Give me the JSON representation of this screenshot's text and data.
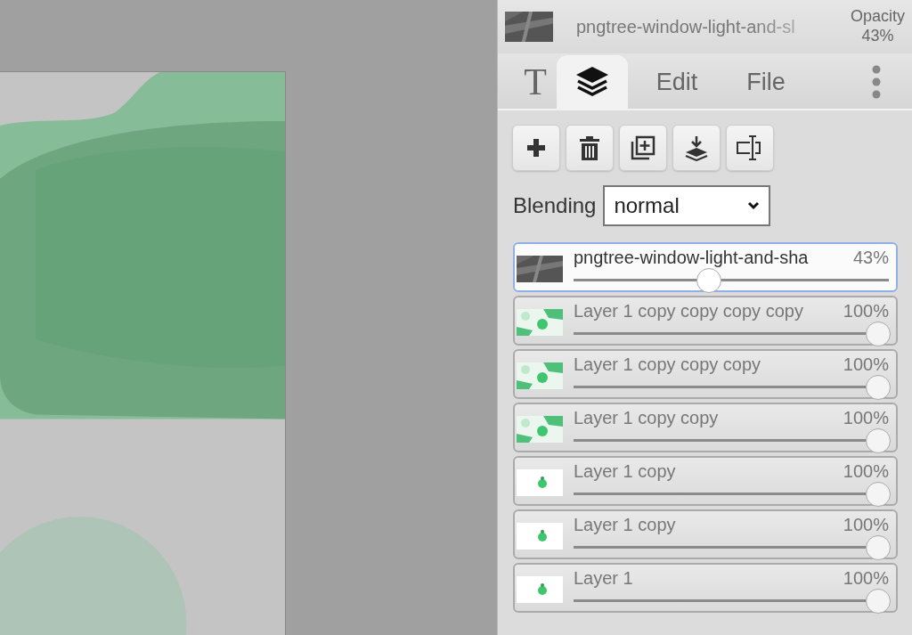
{
  "header": {
    "layer_name": "pngtree-window-light-and-sl",
    "opacity_label": "Opacity",
    "opacity_value": "43%"
  },
  "tabs": [
    {
      "kind": "glyph",
      "label": "T",
      "selected": false
    },
    {
      "kind": "icon",
      "selected": true
    },
    {
      "kind": "text",
      "label": "Edit",
      "selected": false
    },
    {
      "kind": "text",
      "label": "File",
      "selected": false
    }
  ],
  "blending": {
    "label": "Blending",
    "value": "normal"
  },
  "layers": [
    {
      "name": "pngtree-window-light-and-sha",
      "opacity": "43%",
      "level": 0.43,
      "selected": true
    },
    {
      "name": "Layer 1 copy copy copy copy",
      "opacity": "100%",
      "level": 1,
      "selected": false
    },
    {
      "name": "Layer 1 copy copy copy",
      "opacity": "100%",
      "level": 1,
      "selected": false
    },
    {
      "name": "Layer 1 copy copy",
      "opacity": "100%",
      "level": 1,
      "selected": false
    },
    {
      "name": "Layer 1 copy",
      "opacity": "100%",
      "level": 1,
      "selected": false
    },
    {
      "name": "Layer 1 copy",
      "opacity": "100%",
      "level": 1,
      "selected": false
    },
    {
      "name": "Layer 1",
      "opacity": "100%",
      "level": 1,
      "selected": false
    }
  ]
}
